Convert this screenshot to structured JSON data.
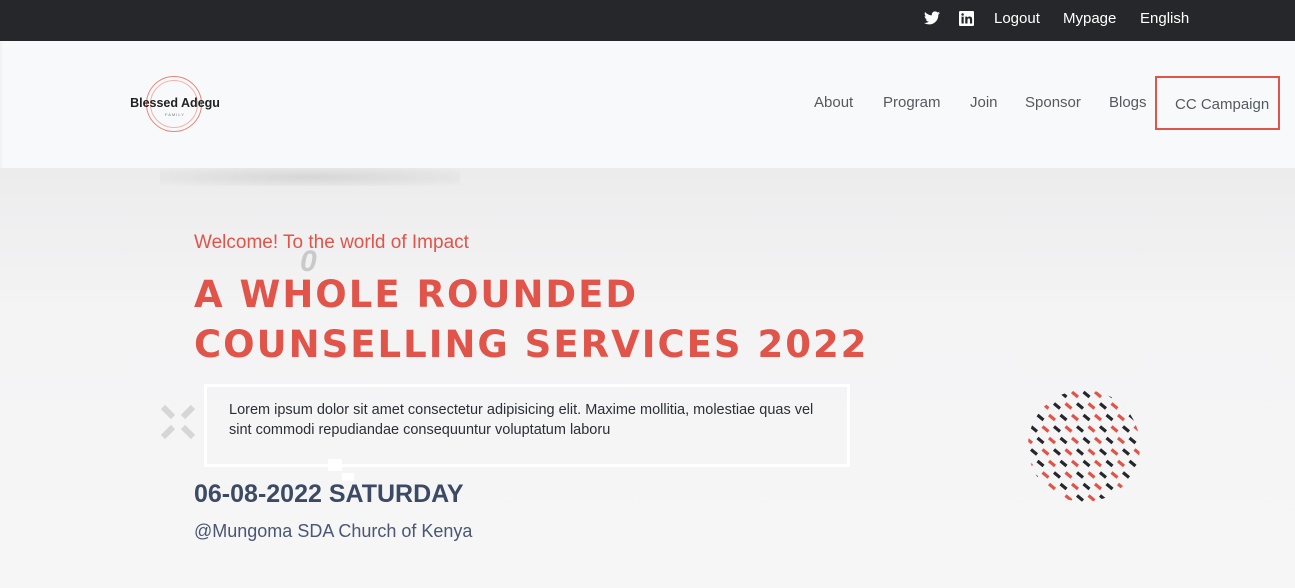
{
  "topbar": {
    "twitter_icon": "twitter-icon",
    "linkedin_icon": "linkedin-icon",
    "logout": "Logout",
    "mypage": "Mypage",
    "language": "English"
  },
  "logo": {
    "name": "Blessed Adegu",
    "sub": "FAMILY"
  },
  "nav": {
    "items": [
      "About",
      "Program",
      "Join",
      "Sponsor",
      "Blogs"
    ],
    "highlight": "CC Campaign"
  },
  "hero": {
    "welcome": "Welcome! To the world of Impact",
    "decor_glyph": "0",
    "title_line1": "A WHOLE ROUNDED",
    "title_line2": "COUNSELLING SERVICES 2022",
    "description": "Lorem ipsum dolor sit amet consectetur adipisicing elit. Maxime mollitia, molestiae quas vel sint commodi repudiandae consequuntur voluptatum laboru",
    "date": "06-08-2022 SATURDAY",
    "venue": "@Mungoma SDA Church of Kenya"
  },
  "colors": {
    "accent": "#e0544a",
    "dark": "#25272b",
    "navy": "#3c4a63"
  }
}
